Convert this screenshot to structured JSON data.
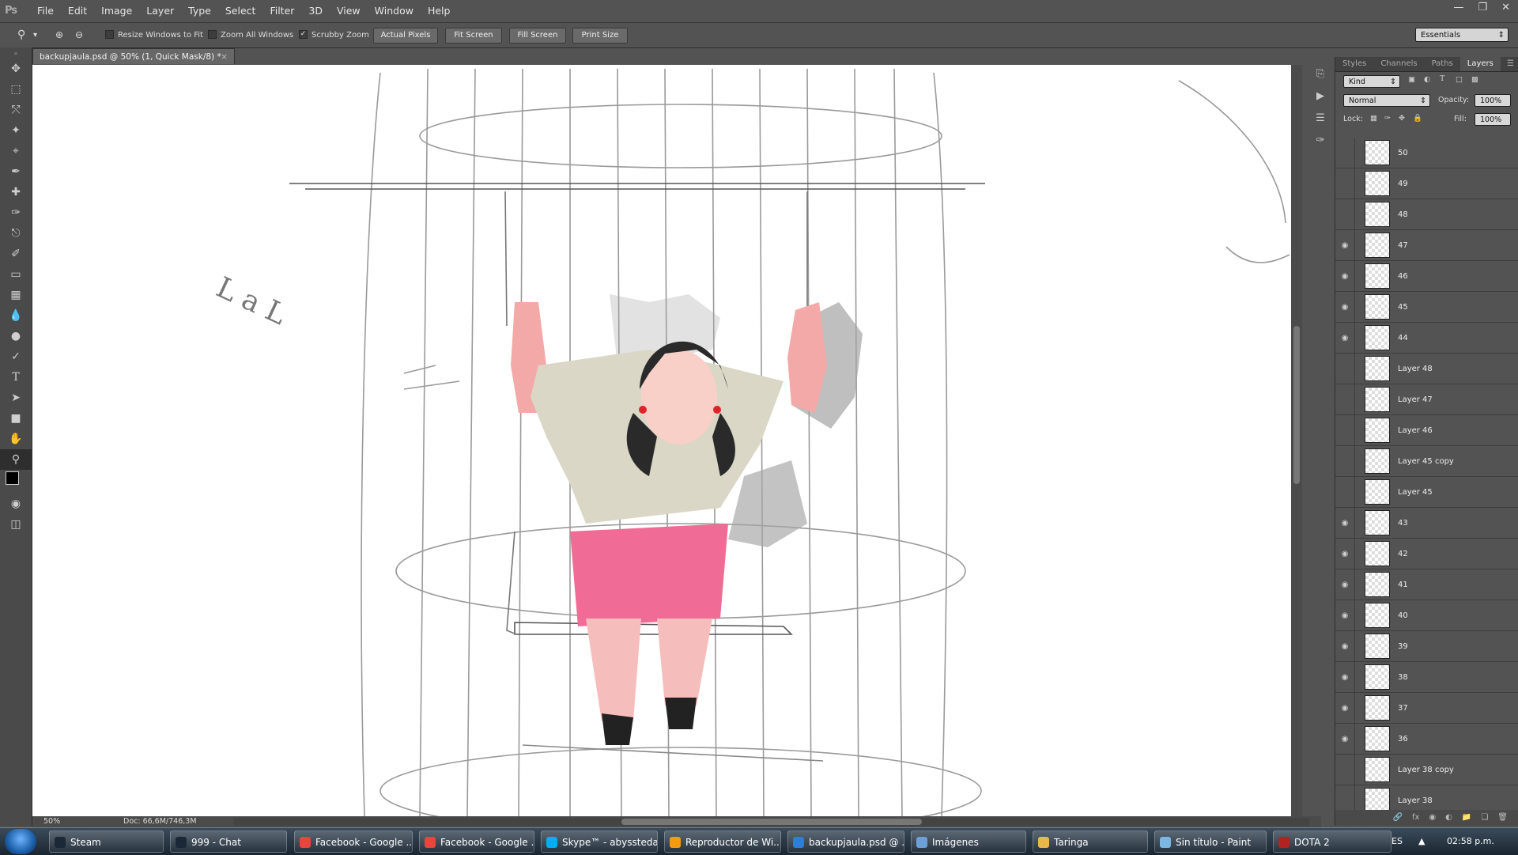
{
  "app": {
    "logo": "Ps",
    "menus": [
      "File",
      "Edit",
      "Image",
      "Layer",
      "Type",
      "Select",
      "Filter",
      "3D",
      "View",
      "Window",
      "Help"
    ]
  },
  "window_controls": [
    "minimize",
    "restore",
    "close"
  ],
  "options": {
    "resize_windows": "Resize Windows to Fit",
    "zoom_all": "Zoom All Windows",
    "scrubby_zoom": "Scrubby Zoom",
    "actual_pixels": "Actual Pixels",
    "fit_screen": "Fit Screen",
    "fill_screen": "Fill Screen",
    "print_size": "Print Size",
    "workspace": "Essentials"
  },
  "document": {
    "tab_title": "backupjaula.psd @ 50% (1, Quick Mask/8) *"
  },
  "status": {
    "zoom": "50%",
    "doc_size": "Doc: 66,6M/746,3M"
  },
  "panel": {
    "tabs": [
      "Styles",
      "Channels",
      "Paths",
      "Layers"
    ],
    "active_tab": "Layers",
    "filter_kind": "Kind",
    "blend_mode": "Normal",
    "opacity_label": "Opacity:",
    "opacity_value": "100%",
    "lock_label": "Lock:",
    "fill_label": "Fill:",
    "fill_value": "100%"
  },
  "layers": [
    {
      "name": "50",
      "visible": false
    },
    {
      "name": "49",
      "visible": false
    },
    {
      "name": "48",
      "visible": false
    },
    {
      "name": "47",
      "visible": true
    },
    {
      "name": "46",
      "visible": true
    },
    {
      "name": "45",
      "visible": true
    },
    {
      "name": "44",
      "visible": true
    },
    {
      "name": "Layer 48",
      "visible": false
    },
    {
      "name": "Layer 47",
      "visible": false
    },
    {
      "name": "Layer 46",
      "visible": false
    },
    {
      "name": "Layer 45 copy",
      "visible": false
    },
    {
      "name": "Layer 45",
      "visible": false
    },
    {
      "name": "43",
      "visible": true
    },
    {
      "name": "42",
      "visible": true
    },
    {
      "name": "41",
      "visible": true
    },
    {
      "name": "40",
      "visible": true
    },
    {
      "name": "39",
      "visible": true
    },
    {
      "name": "38",
      "visible": true
    },
    {
      "name": "37",
      "visible": true
    },
    {
      "name": "36",
      "visible": true
    },
    {
      "name": "Layer 38 copy",
      "visible": false
    },
    {
      "name": "Layer 38",
      "visible": false
    }
  ],
  "canvas_sketch_text": "L a L",
  "taskbar": {
    "tasks": [
      {
        "label": "Steam",
        "color": "#1b2838"
      },
      {
        "label": "999 - Chat",
        "color": "#1b2838"
      },
      {
        "label": "Facebook - Google ...",
        "color": "#e8453c"
      },
      {
        "label": "Facebook - Google ...",
        "color": "#e8453c"
      },
      {
        "label": "Skype™ - abyssteda",
        "color": "#00aff0"
      },
      {
        "label": "Reproductor de Wi...",
        "color": "#f39c12"
      },
      {
        "label": "backupjaula.psd @ ...",
        "color": "#2c7fd6"
      },
      {
        "label": "Imágenes",
        "color": "#6ea0d8"
      },
      {
        "label": "Taringa",
        "color": "#e8b84a"
      },
      {
        "label": "Sin título - Paint",
        "color": "#7bb7e0"
      },
      {
        "label": "DOTA 2",
        "color": "#b22222"
      }
    ],
    "language": "ES",
    "time": "02:58 p.m."
  }
}
